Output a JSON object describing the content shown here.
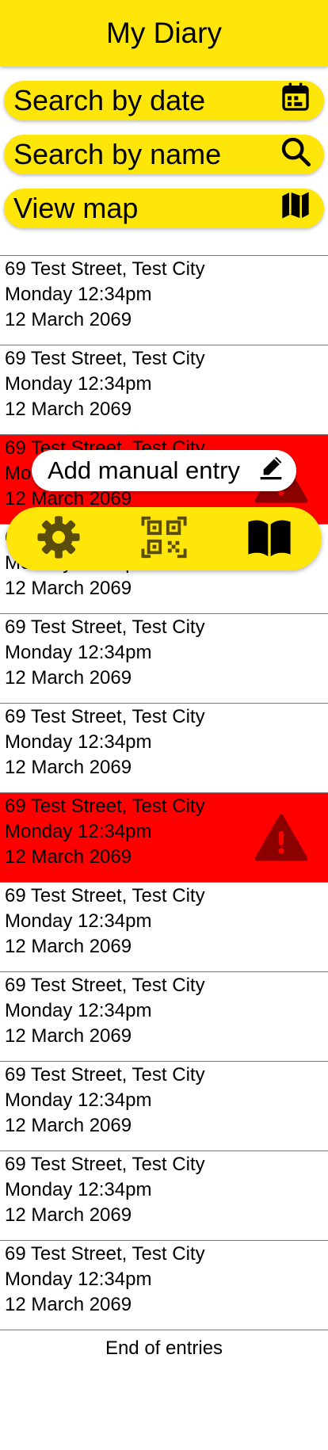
{
  "header": {
    "title": "My Diary"
  },
  "search": {
    "by_date": "Search by date",
    "by_name": "Search by name",
    "view_map": "View map"
  },
  "entries": [
    {
      "address": "69 Test Street, Test City",
      "time": "Monday 12:34pm",
      "date": "12 March 2069",
      "alert": false
    },
    {
      "address": "69 Test Street, Test City",
      "time": "Monday 12:34pm",
      "date": "12 March 2069",
      "alert": false
    },
    {
      "address": "69 Test Street, Test City",
      "time": "Monday 12:34pm",
      "date": "12 March 2069",
      "alert": true
    },
    {
      "address": "69 Test Street, Test City",
      "time": "Monday 12:34pm",
      "date": "12 March 2069",
      "alert": false
    },
    {
      "address": "69 Test Street, Test City",
      "time": "Monday 12:34pm",
      "date": "12 March 2069",
      "alert": false
    },
    {
      "address": "69 Test Street, Test City",
      "time": "Monday 12:34pm",
      "date": "12 March 2069",
      "alert": false
    },
    {
      "address": "69 Test Street, Test City",
      "time": "Monday 12:34pm",
      "date": "12 March 2069",
      "alert": true
    },
    {
      "address": "69 Test Street, Test City",
      "time": "Monday 12:34pm",
      "date": "12 March 2069",
      "alert": false
    },
    {
      "address": "69 Test Street, Test City",
      "time": "Monday 12:34pm",
      "date": "12 March 2069",
      "alert": false
    },
    {
      "address": "69 Test Street, Test City",
      "time": "Monday 12:34pm",
      "date": "12 March 2069",
      "alert": false
    },
    {
      "address": "69 Test Street, Test City",
      "time": "Monday 12:34pm",
      "date": "12 March 2069",
      "alert": false
    },
    {
      "address": "69 Test Street, Test City",
      "time": "Monday 12:34pm",
      "date": "12 March 2069",
      "alert": false
    }
  ],
  "footer": {
    "end_text": "End of entries"
  },
  "manual_entry": {
    "label": "Add manual entry"
  },
  "bottom_nav": {
    "icons": [
      "gear-icon",
      "qr-code-icon",
      "book-icon"
    ]
  },
  "colors": {
    "accent": "#ffe60a",
    "alert": "#ff0000",
    "alert_icon": "#8b0000"
  }
}
